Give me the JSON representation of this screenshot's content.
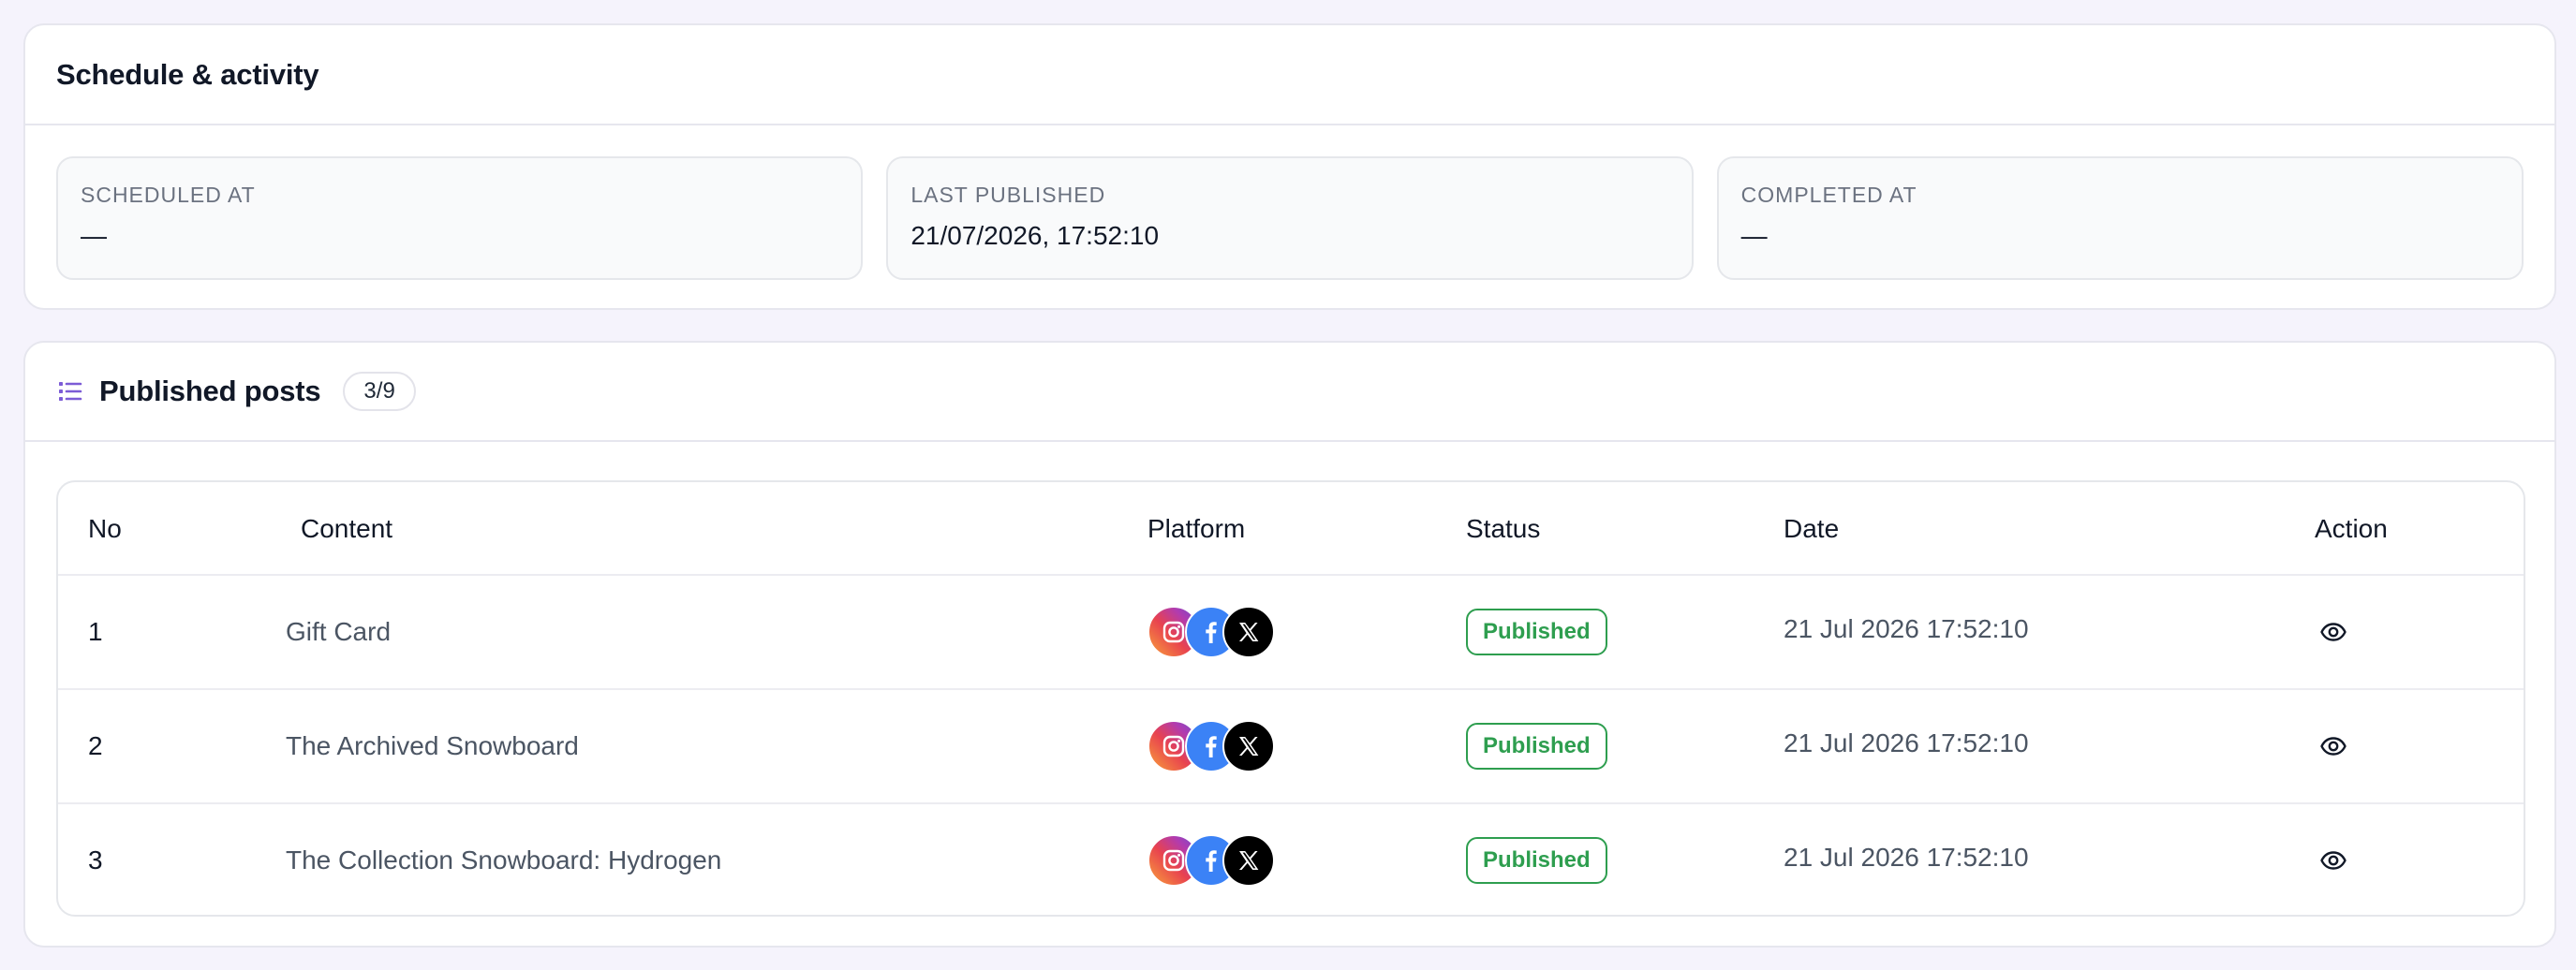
{
  "schedule": {
    "title": "Schedule & activity",
    "stats": [
      {
        "label": "SCHEDULED AT",
        "value": "—"
      },
      {
        "label": "LAST PUBLISHED",
        "value": "21/07/2026, 17:52:10"
      },
      {
        "label": "COMPLETED AT",
        "value": "—"
      }
    ]
  },
  "posts": {
    "title": "Published posts",
    "count": "3/9",
    "icon": "list-icon",
    "columns": [
      "No",
      "Content",
      "Platform",
      "Status",
      "Date",
      "Action"
    ],
    "rows": [
      {
        "no": "1",
        "content": "Gift Card",
        "platforms": [
          "instagram-icon",
          "facebook-icon",
          "x-icon"
        ],
        "status": "Published",
        "date": "21 Jul 2026 17:52:10",
        "action": "eye-icon"
      },
      {
        "no": "2",
        "content": "The Archived Snowboard",
        "platforms": [
          "instagram-icon",
          "facebook-icon",
          "x-icon"
        ],
        "status": "Published",
        "date": "21 Jul 2026 17:52:10",
        "action": "eye-icon"
      },
      {
        "no": "3",
        "content": "The Collection Snowboard: Hydrogen",
        "platforms": [
          "instagram-icon",
          "facebook-icon",
          "x-icon"
        ],
        "status": "Published",
        "date": "21 Jul 2026 17:52:10",
        "action": "eye-icon"
      }
    ]
  },
  "colors": {
    "accent": "#7c5cd6",
    "status_published": "#2e9e4f",
    "facebook": "#3b82f6",
    "x": "#000000"
  }
}
